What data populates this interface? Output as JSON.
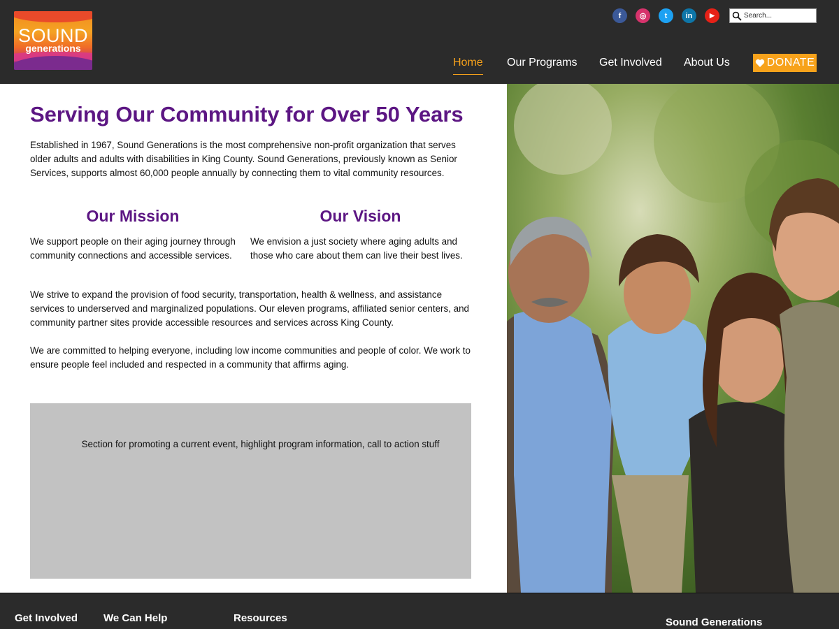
{
  "brand": {
    "logo_line1": "SOUND",
    "logo_line2": "generations",
    "colors": {
      "purple": "#5c1683",
      "orange": "#f7a21b",
      "header_bg": "#2b2b2b",
      "promo_bg": "#c2c2c2"
    }
  },
  "header": {
    "social": [
      {
        "name": "facebook-icon",
        "glyph": "f",
        "color": "#3b5998"
      },
      {
        "name": "instagram-icon",
        "glyph": "◎",
        "color": "#d6336c"
      },
      {
        "name": "twitter-icon",
        "glyph": "t",
        "color": "#1da1f2"
      },
      {
        "name": "linkedin-icon",
        "glyph": "in",
        "color": "#0e76a8"
      },
      {
        "name": "youtube-icon",
        "glyph": "▶",
        "color": "#e62117"
      }
    ],
    "search_placeholder": "Search...",
    "nav": {
      "home": "Home",
      "programs": "Our Programs",
      "involved": "Get Involved",
      "about": "About Us"
    },
    "donate_label": "DONATE"
  },
  "main": {
    "title": "Serving Our Community for Over 50 Years",
    "intro": "Established in 1967, Sound Generations is the most comprehensive non-profit organization that serves older adults and adults with disabilities in King County. Sound Generations, previously known as Senior Services, supports almost 60,000 people annually by connecting them to vital community resources.",
    "mission_heading": "Our Mission",
    "mission_text": "We support people on their aging journey through community connections and accessible services.",
    "vision_heading": "Our Vision",
    "vision_text": "We envision a just society where aging adults and those who care about them can live their best lives.",
    "para1": "We strive to expand the provision of food security, transportation, health & wellness, and assistance services to underserved and marginalized populations. Our eleven programs, affiliated senior centers, and community partner sites provide accessible resources and services across King County.",
    "para2": "We are committed to helping everyone, including low income communities and people of color. We work to ensure people feel included and respected in a community that affirms aging.",
    "promo_text": "Section for promoting a current event, highlight program information, call to action stuff"
  },
  "footer": {
    "col1": "Get Involved",
    "col2": "We Can Help",
    "col3": "Resources",
    "col4": "Sound Generations"
  }
}
